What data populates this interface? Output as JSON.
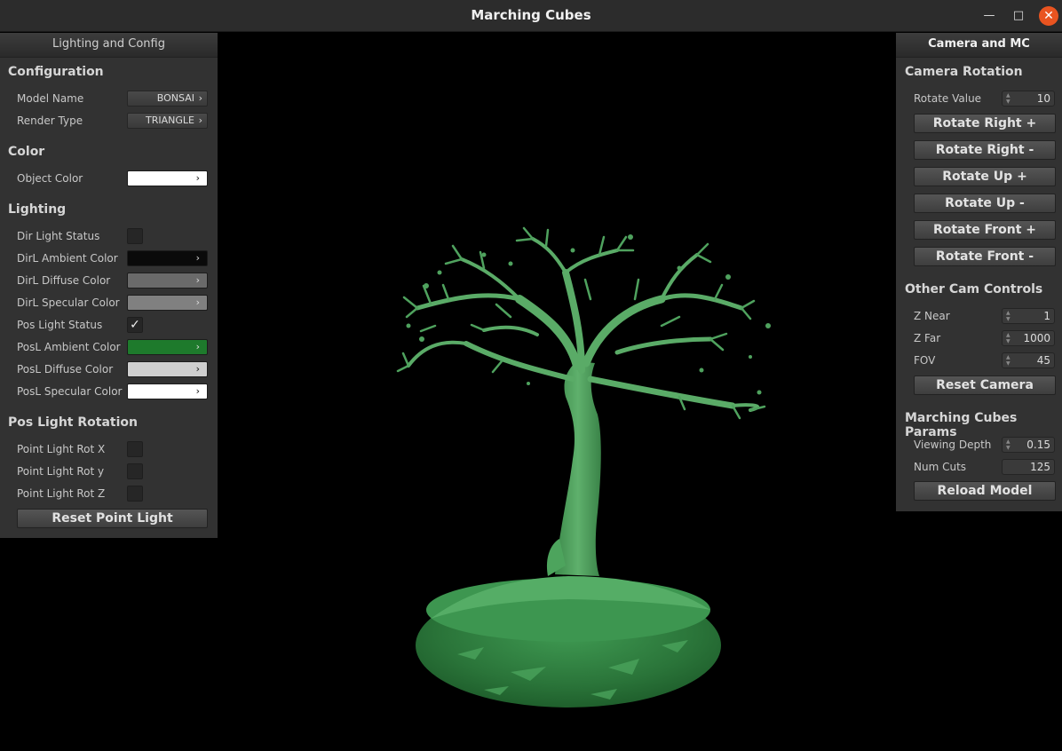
{
  "window": {
    "title": "Marching Cubes",
    "min_glyph": "—",
    "max_glyph": "□",
    "close_glyph": "✕"
  },
  "left_panel": {
    "header": "Lighting and Config",
    "configuration": {
      "title": "Configuration",
      "model_name_label": "Model Name",
      "model_name_value": "BONSAI",
      "render_type_label": "Render Type",
      "render_type_value": "TRIANGLE"
    },
    "color": {
      "title": "Color",
      "object_color_label": "Object Color",
      "object_color": "#ffffff"
    },
    "lighting": {
      "title": "Lighting",
      "dir_light_status_label": "Dir Light Status",
      "dir_light_status": false,
      "dirl_ambient_label": "DirL Ambient Color",
      "dirl_ambient_color": "#0a0a0a",
      "dirl_diffuse_label": "DirL Diffuse Color",
      "dirl_diffuse_color": "#6a6a6a",
      "dirl_specular_label": "DirL Specular Color",
      "dirl_specular_color": "#808080",
      "pos_light_status_label": "Pos Light Status",
      "pos_light_status": true,
      "posl_ambient_label": "PosL Ambient Color",
      "posl_ambient_color": "#1e7a2c",
      "posl_diffuse_label": "PosL Diffuse Color",
      "posl_diffuse_color": "#cfcfcf",
      "posl_specular_label": "PosL Specular Color",
      "posl_specular_color": "#ffffff"
    },
    "pos_light_rotation": {
      "title": "Pos Light Rotation",
      "rot_x_label": "Point Light Rot X",
      "rot_y_label": "Point Light Rot y",
      "rot_z_label": "Point Light Rot Z",
      "reset_label": "Reset Point Light"
    }
  },
  "right_panel": {
    "header": "Camera and MC",
    "camera_rotation": {
      "title": "Camera Rotation",
      "rotate_value_label": "Rotate Value",
      "rotate_value": "10",
      "rotate_right_plus": "Rotate Right +",
      "rotate_right_minus": "Rotate Right -",
      "rotate_up_plus": "Rotate Up +",
      "rotate_up_minus": "Rotate Up -",
      "rotate_front_plus": "Rotate Front +",
      "rotate_front_minus": "Rotate Front -"
    },
    "other_cam_controls": {
      "title": "Other Cam Controls",
      "z_near_label": "Z Near",
      "z_near": "1",
      "z_far_label": "Z Far",
      "z_far": "1000",
      "fov_label": "FOV",
      "fov": "45",
      "reset_camera": "Reset Camera"
    },
    "marching_cubes_params": {
      "title": "Marching Cubes Params",
      "viewing_depth_label": "Viewing Depth",
      "viewing_depth": "0.15",
      "num_cuts_label": "Num Cuts",
      "num_cuts": "125",
      "reload_model": "Reload Model"
    }
  }
}
